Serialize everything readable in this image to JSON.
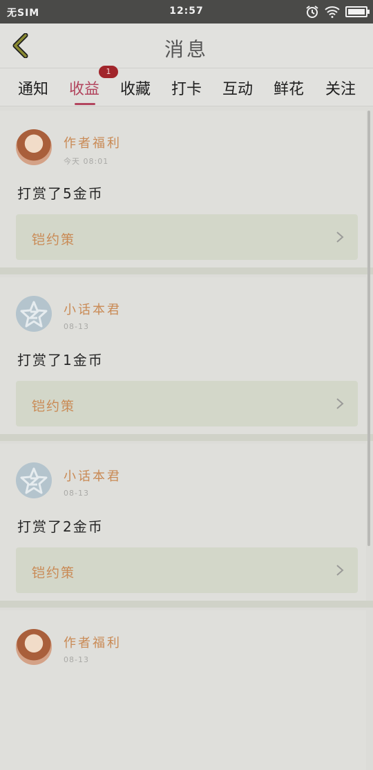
{
  "status_bar": {
    "carrier": "无SIM",
    "time": "12:57"
  },
  "header": {
    "title": "消息"
  },
  "tabs": [
    {
      "label": "通知"
    },
    {
      "label": "收益",
      "active": true,
      "badge": "1"
    },
    {
      "label": "收藏"
    },
    {
      "label": "打卡"
    },
    {
      "label": "互动"
    },
    {
      "label": "鲜花"
    },
    {
      "label": "关注"
    }
  ],
  "cards": [
    {
      "author": "作者福利",
      "time": "今天 08:01",
      "message": "打赏了5金币",
      "link_title": "铠约策",
      "avatar": "photo"
    },
    {
      "author": "小话本君",
      "time": "08-13",
      "message": "打赏了1金币",
      "link_title": "铠约策",
      "avatar": "default"
    },
    {
      "author": "小话本君",
      "time": "08-13",
      "message": "打赏了2金币",
      "link_title": "铠约策",
      "avatar": "default"
    },
    {
      "author": "作者福利",
      "time": "08-13",
      "avatar": "photo"
    }
  ],
  "colors": {
    "accent": "#b2455e",
    "author": "#c98a55",
    "badge": "#a1252b"
  }
}
